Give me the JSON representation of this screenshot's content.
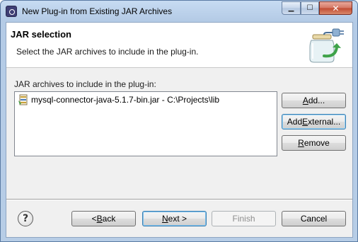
{
  "window": {
    "title": "New Plug-in from Existing JAR Archives",
    "controls": {
      "minimize_glyph": "▁",
      "maximize_glyph": "☐",
      "close_glyph": "✕"
    }
  },
  "header": {
    "title": "JAR selection",
    "description": "Select the JAR archives to include in the plug-in."
  },
  "jar_section": {
    "label": "JAR archives to include in the plug-in:",
    "items": [
      {
        "text": "mysql-connector-java-5.1.7-bin.jar - C:\\Projects\\lib",
        "icon": "jar-file-icon"
      }
    ]
  },
  "side_buttons": {
    "add": {
      "pre": "",
      "mnemonic": "A",
      "post": "dd..."
    },
    "add_external": {
      "pre": "Add ",
      "mnemonic": "E",
      "post": "xternal..."
    },
    "remove": {
      "pre": "",
      "mnemonic": "R",
      "post": "emove"
    }
  },
  "footer": {
    "help_glyph": "?",
    "back": {
      "pre": "< ",
      "mnemonic": "B",
      "post": "ack"
    },
    "next": {
      "pre": "",
      "mnemonic": "N",
      "post": "ext >"
    },
    "finish": {
      "label": "Finish",
      "enabled": false
    },
    "cancel": {
      "label": "Cancel"
    }
  },
  "colors": {
    "title_bar": "#b7cde6",
    "client_bg": "#f0f0f0",
    "close_button": "#c14a31",
    "focus_border": "#3c7fb1"
  }
}
